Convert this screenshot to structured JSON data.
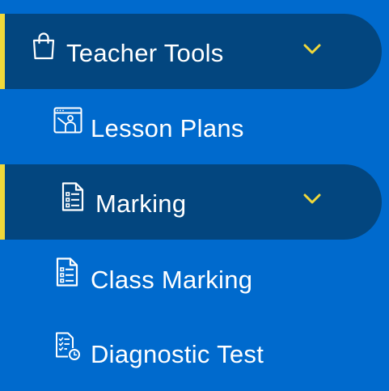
{
  "colors": {
    "background": "#006acd",
    "active_bg": "#03467f",
    "accent": "#f0d83a",
    "text": "#ffffff"
  },
  "menu": {
    "teacher_tools": {
      "label": "Teacher Tools",
      "icon": "shopping-bag-icon",
      "state": "expanded"
    },
    "lesson_plans": {
      "label": "Lesson Plans",
      "icon": "classroom-board-icon"
    },
    "marking": {
      "label": "Marking",
      "icon": "document-list-icon",
      "state": "expanded"
    },
    "class_marking": {
      "label": "Class Marking",
      "icon": "document-list-icon"
    },
    "diagnostic_test": {
      "label": "Diagnostic Test",
      "icon": "checklist-clock-icon"
    }
  }
}
